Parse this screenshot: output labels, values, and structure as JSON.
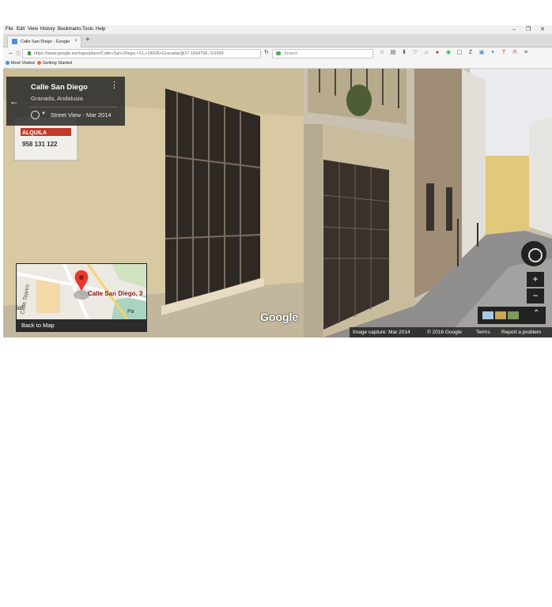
{
  "menu": [
    "File",
    "Edit",
    "View",
    "History",
    "Bookmarks",
    "Tools",
    "Help"
  ],
  "window_controls": [
    "–",
    "❐",
    "✕"
  ],
  "tab": {
    "title": "Calle San Diego - Google ...",
    "close": "×"
  },
  "new_tab": "+",
  "address": {
    "url": "https://www.google.es/maps/place/Calle+San+Diego,+31,+18005+Granada/@37.1694706,-3.5990"
  },
  "search": {
    "placeholder": "Search"
  },
  "bookmarks": [
    "Most Visited",
    "Getting Started"
  ],
  "street_view": {
    "place_title": "Calle San Diego",
    "place_subtitle": "Granada, Andalusia",
    "date": "Street View - Mar 2014",
    "back_arrow": "←",
    "more": "⋮",
    "google_logo": "Google",
    "zoom_in": "+",
    "zoom_out": "−",
    "expand": "⌃"
  },
  "minimap": {
    "address": "Calle San Diego, 3",
    "back_label": "Back to Map",
    "street_label": "Calle Tejeiro",
    "partial_label": "ial",
    "partial_label2": "Pa"
  },
  "footer": {
    "capture": "Image capture: Mar 2014",
    "copyright": "© 2016 Google",
    "terms": "Terms",
    "report": "Report a problem"
  },
  "sign": {
    "phone": "958 131 122",
    "label": "ALQUILA"
  },
  "colors": {
    "accent": "#4285f4",
    "pin": "#e8372b"
  }
}
